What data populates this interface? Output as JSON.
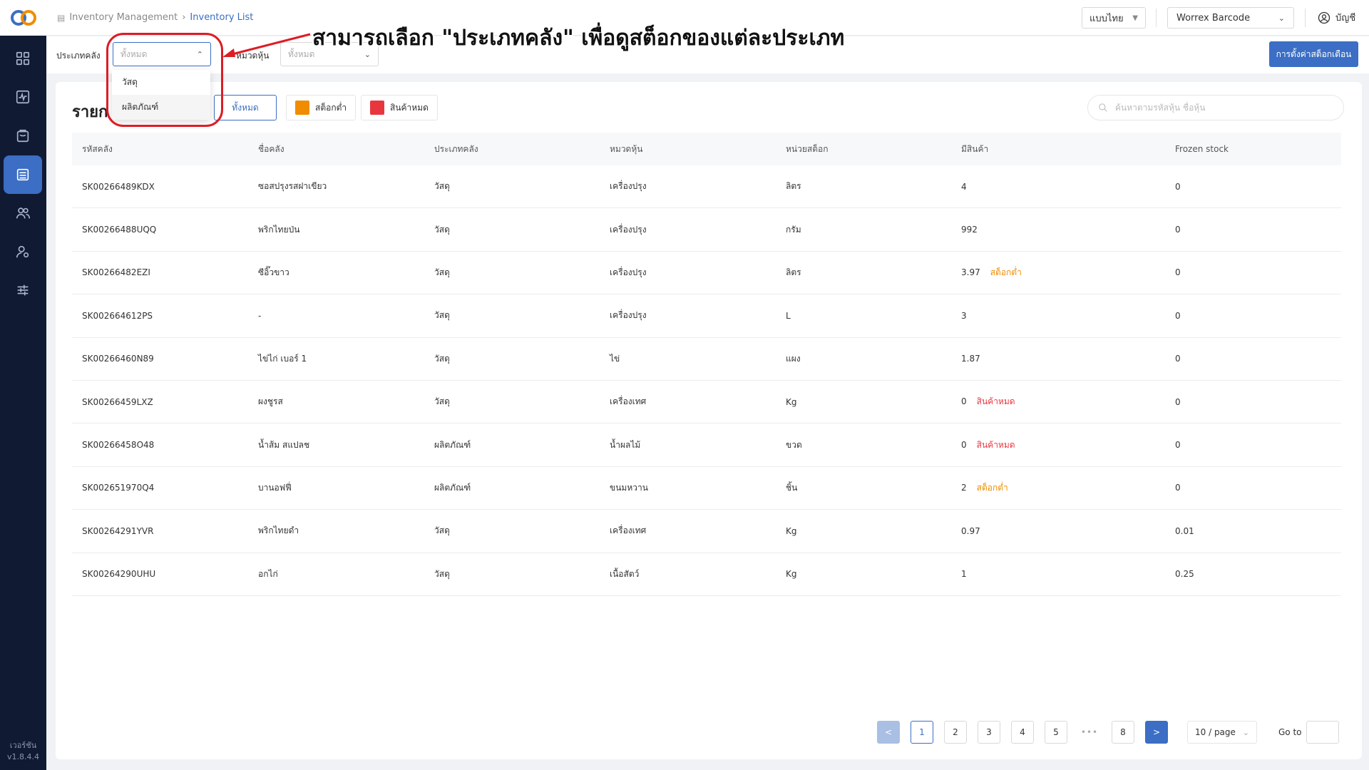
{
  "sidebar": {
    "items": [
      {
        "icon": "grid-icon"
      },
      {
        "icon": "activity-icon"
      },
      {
        "icon": "bag-icon"
      },
      {
        "icon": "inventory-icon",
        "active": true
      },
      {
        "icon": "users-icon"
      },
      {
        "icon": "user-settings-icon"
      },
      {
        "icon": "sliders-icon"
      }
    ],
    "version_label": "เวอร์ชัน",
    "version_number": "v1.8.4.4"
  },
  "header": {
    "breadcrumb": [
      "Inventory Management",
      "Inventory List"
    ],
    "language": "แบบไทย",
    "store": "Worrex Barcode",
    "account": "บัญชี"
  },
  "filters": {
    "warehouse_type_label": "ประเภทคลัง",
    "warehouse_type_value": "ทั้งหมด",
    "category_label": "หมวดหุ้น",
    "category_value": "ทั้งหมด",
    "settings_button": "การตั้งค่าสต็อกเตือน"
  },
  "dropdown": {
    "options": [
      "วัสดุ",
      "ผลิตภัณฑ์"
    ]
  },
  "annotation": {
    "text": "สามารถเลือก \"ประเภทคลัง\" เพื่อดูสต็อกของแต่ละประเภท",
    "color": "#dd1c25"
  },
  "card": {
    "title": "รายก",
    "legend_all": "ทั้งหมด",
    "legend_low": "สต็อกต่ำ",
    "legend_out": "สินค้าหมด",
    "low_color": "#f08c00",
    "out_color": "#e8363f",
    "search_placeholder": "ค้นหาตามรหัสหุ้น ชื่อหุ้น"
  },
  "table": {
    "headers": [
      "รหัสคลัง",
      "ชื่อคลัง",
      "ประเภทคลัง",
      "หมวดหุ้น",
      "หน่วยสต็อก",
      "มีสินค้า",
      "Frozen stock"
    ],
    "rows": [
      {
        "code": "SK00266489KDX",
        "name": "ซอสปรุงรสฝาเขียว",
        "type": "วัสดุ",
        "category": "เครื่องปรุง",
        "unit": "ลิตร",
        "qty": "4",
        "status": "",
        "frozen": "0"
      },
      {
        "code": "SK00266488UQQ",
        "name": "พริกไทยป่น",
        "type": "วัสดุ",
        "category": "เครื่องปรุง",
        "unit": "กรัม",
        "qty": "992",
        "status": "",
        "frozen": "0"
      },
      {
        "code": "SK00266482EZI",
        "name": "ซีอิ๊วขาว",
        "type": "วัสดุ",
        "category": "เครื่องปรุง",
        "unit": "ลิตร",
        "qty": "3.97",
        "status": "สต็อกต่ำ",
        "status_kind": "low",
        "frozen": "0"
      },
      {
        "code": "SK002664612PS",
        "name": "-",
        "type": "วัสดุ",
        "category": "เครื่องปรุง",
        "unit": "L",
        "qty": "3",
        "status": "",
        "frozen": "0"
      },
      {
        "code": "SK00266460N89",
        "name": "ไข่ไก่ เบอร์ 1",
        "type": "วัสดุ",
        "category": "ไข่",
        "unit": "แผง",
        "qty": "1.87",
        "status": "",
        "frozen": "0"
      },
      {
        "code": "SK00266459LXZ",
        "name": "ผงชูรส",
        "type": "วัสดุ",
        "category": "เครื่องเทศ",
        "unit": "Kg",
        "qty": "0",
        "status": "สินค้าหมด",
        "status_kind": "out",
        "frozen": "0"
      },
      {
        "code": "SK00266458O48",
        "name": "น้ำส้ม สแปลช",
        "type": "ผลิตภัณฑ์",
        "category": "น้ำผลไม้",
        "unit": "ขวด",
        "qty": "0",
        "status": "สินค้าหมด",
        "status_kind": "out",
        "frozen": "0"
      },
      {
        "code": "SK002651970Q4",
        "name": "บานอฟฟี่",
        "type": "ผลิตภัณฑ์",
        "category": "ขนมหวาน",
        "unit": "ชิ้น",
        "qty": "2",
        "status": "สต็อกต่ำ",
        "status_kind": "low",
        "frozen": "0"
      },
      {
        "code": "SK00264291YVR",
        "name": "พริกไทยดำ",
        "type": "วัสดุ",
        "category": "เครื่องเทศ",
        "unit": "Kg",
        "qty": "0.97",
        "status": "",
        "frozen": "0.01"
      },
      {
        "code": "SK00264290UHU",
        "name": "อกไก่",
        "type": "วัสดุ",
        "category": "เนื้อสัตว์",
        "unit": "Kg",
        "qty": "1",
        "status": "",
        "frozen": "0.25"
      }
    ]
  },
  "pagination": {
    "prev": "<",
    "pages": [
      "1",
      "2",
      "3",
      "4",
      "5"
    ],
    "ellipsis": "•••",
    "last": "8",
    "next": ">",
    "current": "1",
    "page_size": "10 / page",
    "goto_label": "Go to"
  }
}
